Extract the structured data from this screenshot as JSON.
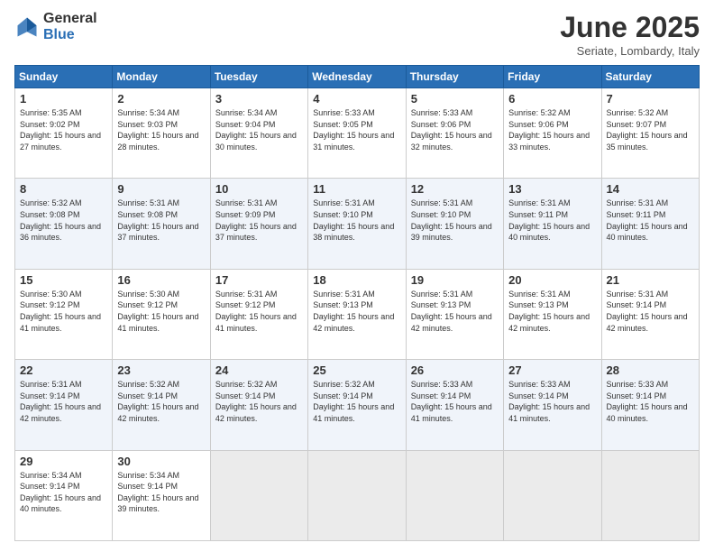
{
  "header": {
    "logo_general": "General",
    "logo_blue": "Blue",
    "month_title": "June 2025",
    "location": "Seriate, Lombardy, Italy"
  },
  "days_of_week": [
    "Sunday",
    "Monday",
    "Tuesday",
    "Wednesday",
    "Thursday",
    "Friday",
    "Saturday"
  ],
  "weeks": [
    [
      {
        "day": "1",
        "sunrise": "5:35 AM",
        "sunset": "9:02 PM",
        "daylight": "15 hours and 27 minutes."
      },
      {
        "day": "2",
        "sunrise": "5:34 AM",
        "sunset": "9:03 PM",
        "daylight": "15 hours and 28 minutes."
      },
      {
        "day": "3",
        "sunrise": "5:34 AM",
        "sunset": "9:04 PM",
        "daylight": "15 hours and 30 minutes."
      },
      {
        "day": "4",
        "sunrise": "5:33 AM",
        "sunset": "9:05 PM",
        "daylight": "15 hours and 31 minutes."
      },
      {
        "day": "5",
        "sunrise": "5:33 AM",
        "sunset": "9:06 PM",
        "daylight": "15 hours and 32 minutes."
      },
      {
        "day": "6",
        "sunrise": "5:32 AM",
        "sunset": "9:06 PM",
        "daylight": "15 hours and 33 minutes."
      },
      {
        "day": "7",
        "sunrise": "5:32 AM",
        "sunset": "9:07 PM",
        "daylight": "15 hours and 35 minutes."
      }
    ],
    [
      {
        "day": "8",
        "sunrise": "5:32 AM",
        "sunset": "9:08 PM",
        "daylight": "15 hours and 36 minutes."
      },
      {
        "day": "9",
        "sunrise": "5:31 AM",
        "sunset": "9:08 PM",
        "daylight": "15 hours and 37 minutes."
      },
      {
        "day": "10",
        "sunrise": "5:31 AM",
        "sunset": "9:09 PM",
        "daylight": "15 hours and 37 minutes."
      },
      {
        "day": "11",
        "sunrise": "5:31 AM",
        "sunset": "9:10 PM",
        "daylight": "15 hours and 38 minutes."
      },
      {
        "day": "12",
        "sunrise": "5:31 AM",
        "sunset": "9:10 PM",
        "daylight": "15 hours and 39 minutes."
      },
      {
        "day": "13",
        "sunrise": "5:31 AM",
        "sunset": "9:11 PM",
        "daylight": "15 hours and 40 minutes."
      },
      {
        "day": "14",
        "sunrise": "5:31 AM",
        "sunset": "9:11 PM",
        "daylight": "15 hours and 40 minutes."
      }
    ],
    [
      {
        "day": "15",
        "sunrise": "5:30 AM",
        "sunset": "9:12 PM",
        "daylight": "15 hours and 41 minutes."
      },
      {
        "day": "16",
        "sunrise": "5:30 AM",
        "sunset": "9:12 PM",
        "daylight": "15 hours and 41 minutes."
      },
      {
        "day": "17",
        "sunrise": "5:31 AM",
        "sunset": "9:12 PM",
        "daylight": "15 hours and 41 minutes."
      },
      {
        "day": "18",
        "sunrise": "5:31 AM",
        "sunset": "9:13 PM",
        "daylight": "15 hours and 42 minutes."
      },
      {
        "day": "19",
        "sunrise": "5:31 AM",
        "sunset": "9:13 PM",
        "daylight": "15 hours and 42 minutes."
      },
      {
        "day": "20",
        "sunrise": "5:31 AM",
        "sunset": "9:13 PM",
        "daylight": "15 hours and 42 minutes."
      },
      {
        "day": "21",
        "sunrise": "5:31 AM",
        "sunset": "9:14 PM",
        "daylight": "15 hours and 42 minutes."
      }
    ],
    [
      {
        "day": "22",
        "sunrise": "5:31 AM",
        "sunset": "9:14 PM",
        "daylight": "15 hours and 42 minutes."
      },
      {
        "day": "23",
        "sunrise": "5:32 AM",
        "sunset": "9:14 PM",
        "daylight": "15 hours and 42 minutes."
      },
      {
        "day": "24",
        "sunrise": "5:32 AM",
        "sunset": "9:14 PM",
        "daylight": "15 hours and 42 minutes."
      },
      {
        "day": "25",
        "sunrise": "5:32 AM",
        "sunset": "9:14 PM",
        "daylight": "15 hours and 41 minutes."
      },
      {
        "day": "26",
        "sunrise": "5:33 AM",
        "sunset": "9:14 PM",
        "daylight": "15 hours and 41 minutes."
      },
      {
        "day": "27",
        "sunrise": "5:33 AM",
        "sunset": "9:14 PM",
        "daylight": "15 hours and 41 minutes."
      },
      {
        "day": "28",
        "sunrise": "5:33 AM",
        "sunset": "9:14 PM",
        "daylight": "15 hours and 40 minutes."
      }
    ],
    [
      {
        "day": "29",
        "sunrise": "5:34 AM",
        "sunset": "9:14 PM",
        "daylight": "15 hours and 40 minutes."
      },
      {
        "day": "30",
        "sunrise": "5:34 AM",
        "sunset": "9:14 PM",
        "daylight": "15 hours and 39 minutes."
      },
      null,
      null,
      null,
      null,
      null
    ]
  ]
}
